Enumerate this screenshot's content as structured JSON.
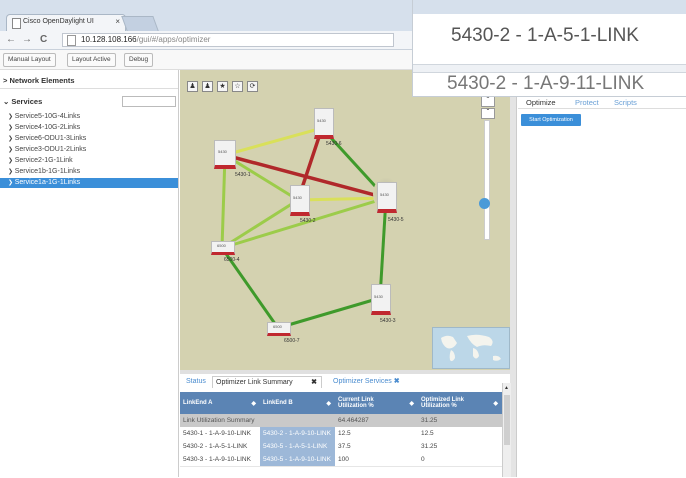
{
  "browser": {
    "tab_title": "Cisco OpenDaylight UI",
    "tab_close": "×",
    "url_host": "10.128.108.166",
    "url_path": "/gui/#/apps/optimizer"
  },
  "toolbar": {
    "manual_layout": "Manual Layout",
    "layout_active": "Layout Active",
    "debug": "Debug"
  },
  "left_panel": {
    "network_elements": "Network Elements",
    "services": "Services",
    "items": [
      "Service5-10G-4Links",
      "Service4-10G-2Links",
      "Service6-ODU1-3Links",
      "Service3-ODU1-2Links",
      "Service2-1G-1Link",
      "Service1b-1G-1Links",
      "Service1a-1G-1Links"
    ],
    "selected_index": 6
  },
  "map": {
    "nodes": [
      "5430-1",
      "5430-6",
      "5430-2",
      "5430-5",
      "6500-4",
      "5430-3",
      "6500-7"
    ],
    "node_badges": [
      "5430",
      "5430",
      "5430",
      "5430",
      "6500",
      "5430",
      "6500"
    ]
  },
  "right_panel": {
    "tabs": [
      "Optimize",
      "Protect",
      "Scripts"
    ],
    "start_button": "Start Optimization"
  },
  "bottom_panel": {
    "tabs": [
      "Status",
      "Optimizer Link Summary",
      "Optimizer Services"
    ],
    "columns": [
      "LinkEnd A",
      "LinkEnd B",
      "Current Link Utilization %",
      "Optimized Link Utilization %"
    ],
    "summary_row": {
      "label": "Link Utilization Summary",
      "current": "64.464287",
      "optimized": "31.25"
    },
    "rows": [
      [
        "5430-1 - 1-A-9-10-LINK",
        "5430-2 - 1-A-9-10-LINK",
        "12.5",
        "12.5"
      ],
      [
        "5430-2 - 1-A-5-1-LINK",
        "5430-5 - 1-A-5-1-LINK",
        "37.5",
        "31.25"
      ],
      [
        "5430-3 - 1-A-9-10-LINK",
        "5430-5 - 1-A-9-10-LINK",
        "100",
        "0"
      ]
    ]
  },
  "zoom_overlay": {
    "line1": "5430-2 - 1-A-5-1-LINK",
    "line2": "5430-2 - 1-A-9-11-LINK"
  },
  "colors": {
    "link_red": "#b0282a",
    "link_green": "#3f9a2b",
    "link_lightgreen": "#9ccc4a",
    "link_yellow": "#d9e05a",
    "selection_blue": "#3b8fd9",
    "table_header": "#5b84b4"
  }
}
